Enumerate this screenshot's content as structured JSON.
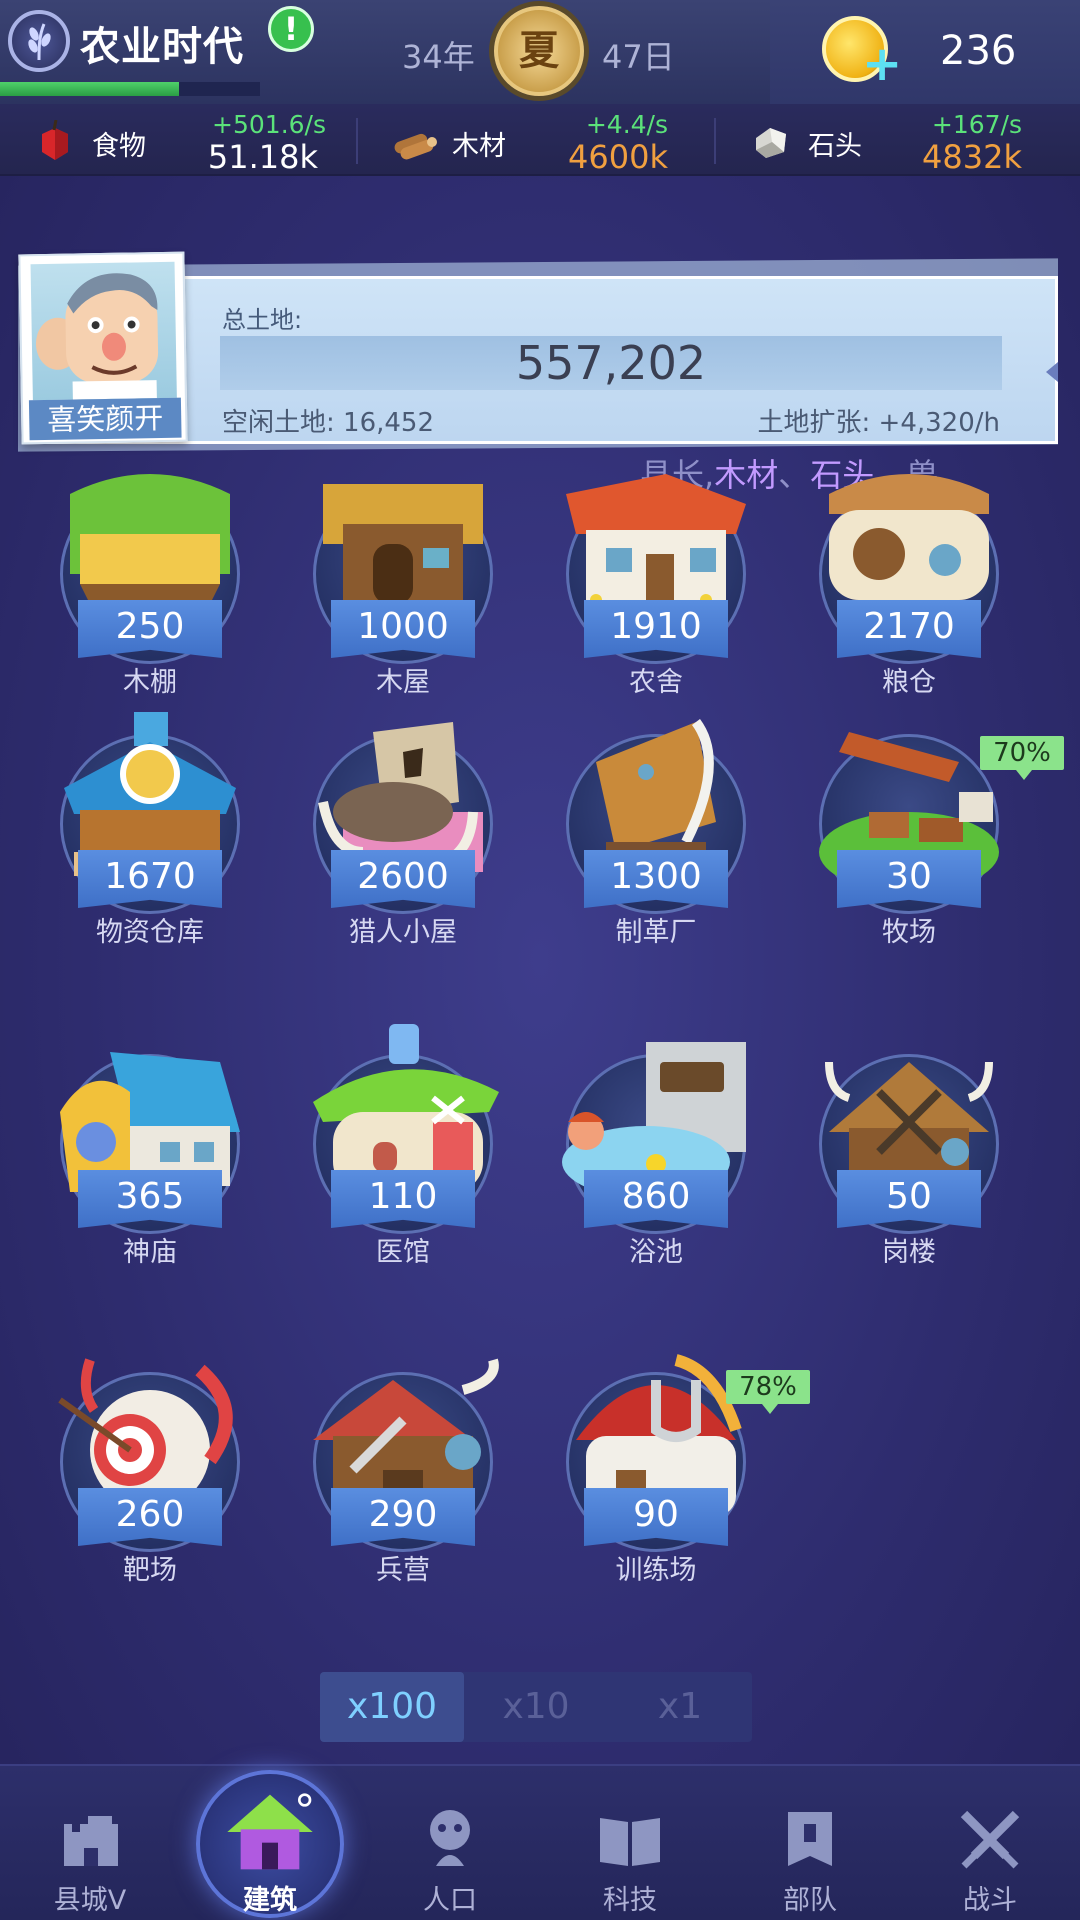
{
  "top": {
    "era_title": "农业时代",
    "era_progress": 0.69,
    "year": "34年",
    "season": "夏",
    "day": "47日",
    "coins": "236",
    "alert_icon": "exclamation-icon"
  },
  "resources": [
    {
      "name": "食物",
      "rate": "+501.6/s",
      "amount": "51.18k",
      "amount_color": "#ffffff",
      "icon": "apple-icon"
    },
    {
      "name": "木材",
      "rate": "+4.4/s",
      "amount": "4600k",
      "amount_color": "#f0a040",
      "icon": "wood-icon"
    },
    {
      "name": "石头",
      "rate": "+167/s",
      "amount": "4832k",
      "amount_color": "#f0a040",
      "icon": "stone-icon"
    }
  ],
  "governor": {
    "name": "喜笑颜开",
    "land_label": "总土地:",
    "land_total": "557,202",
    "idle_land": "空闲土地: 16,452",
    "expansion": "土地扩张: +4,320/h"
  },
  "marquee": {
    "prefix": "县长,",
    "highlight_1": "木材",
    "sep_1": "、",
    "highlight_2": "石头",
    "sep_2": "、兽"
  },
  "buildings": [
    {
      "name": "木棚",
      "count": "250",
      "art": "shed"
    },
    {
      "name": "木屋",
      "count": "1000",
      "art": "cabin"
    },
    {
      "name": "农舍",
      "count": "1910",
      "art": "farmhouse"
    },
    {
      "name": "粮仓",
      "count": "2170",
      "art": "granary"
    },
    {
      "name": "物资仓库",
      "count": "1670",
      "art": "warehouse"
    },
    {
      "name": "猎人小屋",
      "count": "2600",
      "art": "hunter"
    },
    {
      "name": "制革厂",
      "count": "1300",
      "art": "tannery"
    },
    {
      "name": "牧场",
      "count": "30",
      "art": "ranch",
      "badge": "70%"
    },
    {
      "name": "神庙",
      "count": "365",
      "art": "temple"
    },
    {
      "name": "医馆",
      "count": "110",
      "art": "clinic"
    },
    {
      "name": "浴池",
      "count": "860",
      "art": "bath"
    },
    {
      "name": "岗楼",
      "count": "50",
      "art": "watchtower"
    },
    {
      "name": "靶场",
      "count": "260",
      "art": "range"
    },
    {
      "name": "兵营",
      "count": "290",
      "art": "barracks"
    },
    {
      "name": "训练场",
      "count": "90",
      "art": "training",
      "badge": "78%"
    }
  ],
  "multipliers": [
    "x100",
    "x10",
    "x1"
  ],
  "multiplier_selected": "x100",
  "nav": [
    {
      "label": "县城Ⅴ",
      "icon": "castle-icon"
    },
    {
      "label": "建筑",
      "icon": "house-icon",
      "active": true
    },
    {
      "label": "人口",
      "icon": "person-icon"
    },
    {
      "label": "科技",
      "icon": "book-icon"
    },
    {
      "label": "部队",
      "icon": "banner-icon"
    },
    {
      "label": "战斗",
      "icon": "crossed-swords-icon"
    }
  ],
  "colors": {
    "background": "#2e2c6e",
    "ribbon": "#4a7fd6",
    "rate_green": "#5be27a",
    "amount_orange": "#f0a040",
    "badge_green": "#8be38b"
  }
}
